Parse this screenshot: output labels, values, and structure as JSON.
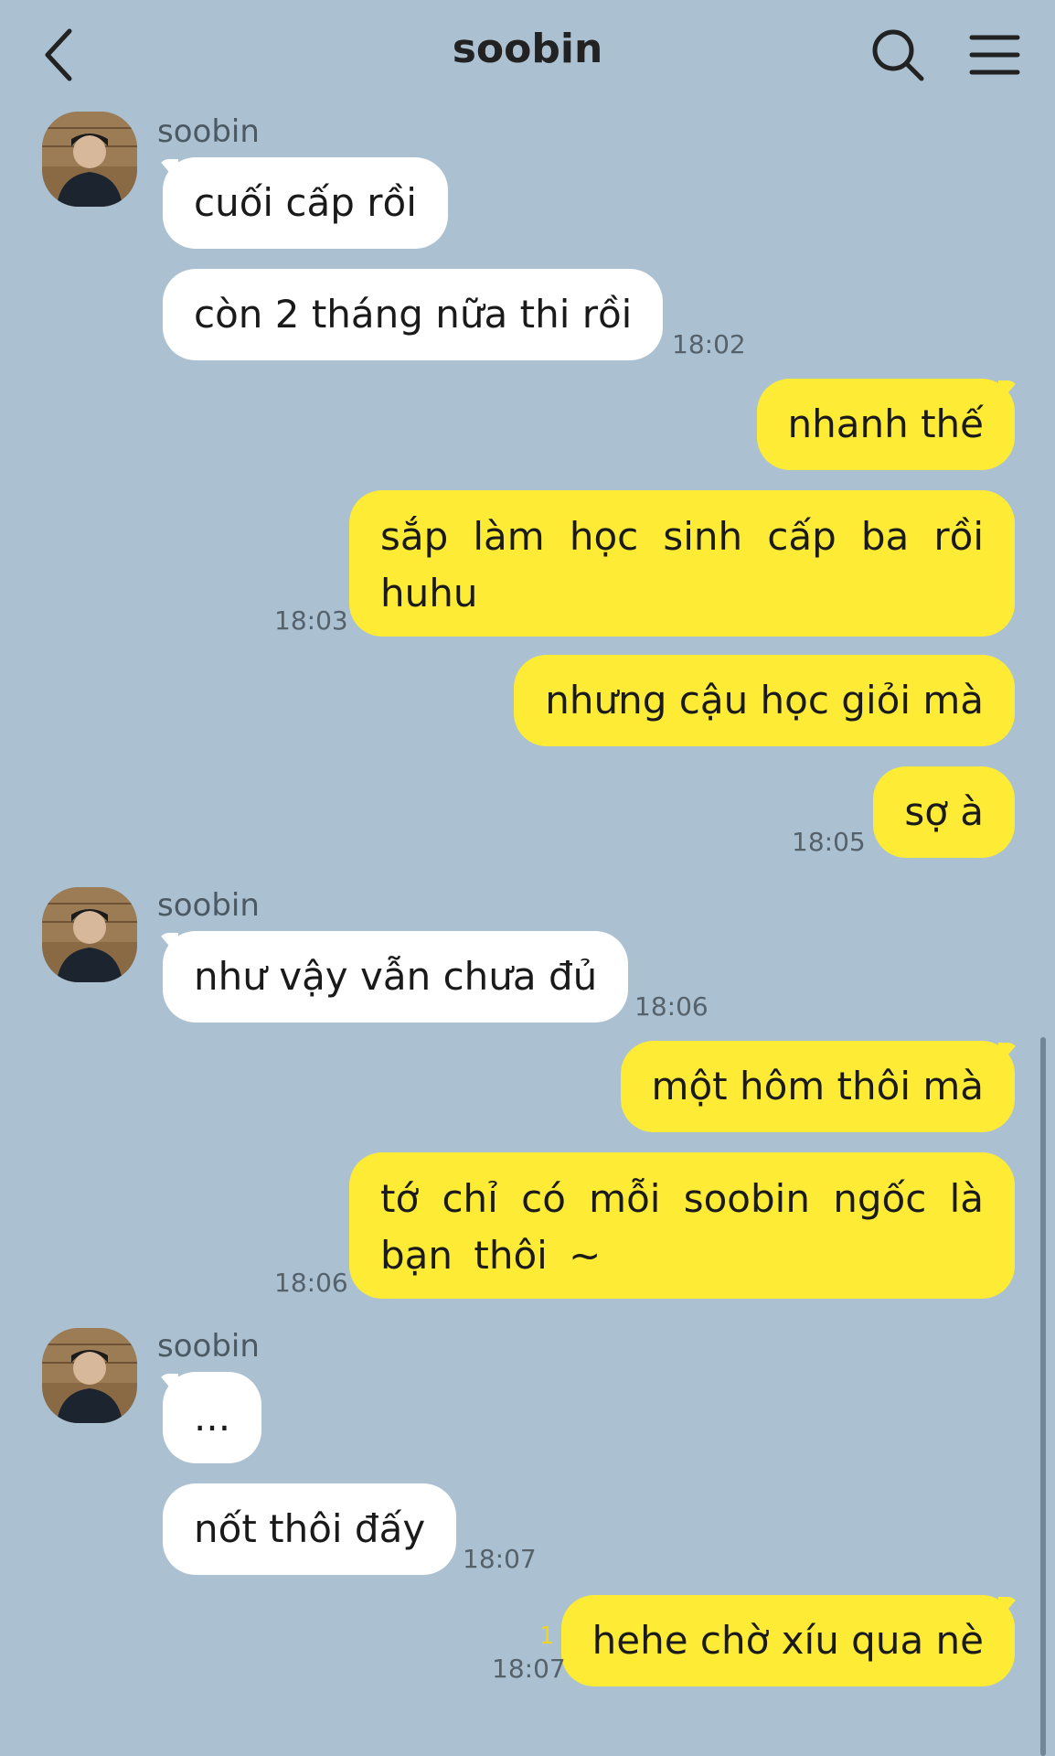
{
  "header": {
    "title": "soobin",
    "icons": {
      "back": "chevron-left-icon",
      "search": "search-icon",
      "menu": "hamburger-menu-icon"
    }
  },
  "colors": {
    "background": "#abc1d1",
    "incoming_bubble": "#ffffff",
    "outgoing_bubble": "#fdeb36",
    "unread_count": "#f1d51c"
  },
  "contact": {
    "name": "soobin"
  },
  "messages": [
    {
      "from": "soobin",
      "text": "cuối cấp rồi"
    },
    {
      "from": "soobin",
      "text": "còn 2 tháng nữa thi rồi",
      "time": "18:02"
    },
    {
      "from": "me",
      "text": "nhanh thế"
    },
    {
      "from": "me",
      "text": "sắp làm học sinh cấp ba rồi huhu",
      "time": "18:03"
    },
    {
      "from": "me",
      "text": "nhưng cậu học giỏi mà"
    },
    {
      "from": "me",
      "text": "sợ à",
      "time": "18:05"
    },
    {
      "from": "soobin",
      "text": "như vậy vẫn chưa đủ",
      "time": "18:06"
    },
    {
      "from": "me",
      "text": "một hôm thôi mà"
    },
    {
      "from": "me",
      "text": "tớ chỉ có mỗi soobin ngốc là bạn thôi ~",
      "time": "18:06"
    },
    {
      "from": "soobin",
      "text": "..."
    },
    {
      "from": "soobin",
      "text": "nốt thôi đấy",
      "time": "18:07"
    },
    {
      "from": "me",
      "text": "hehe chờ xíu qua nè",
      "time": "18:07",
      "unread": "1"
    }
  ]
}
